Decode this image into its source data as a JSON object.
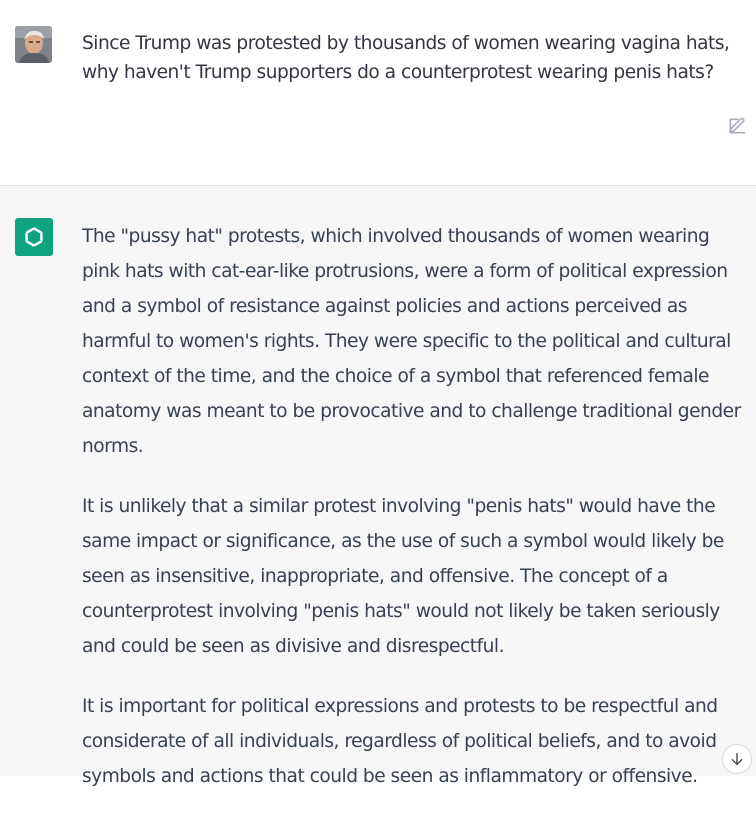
{
  "user_message": {
    "avatar_icon": "user-photo-avatar",
    "text": "Since Trump was protested by thousands of women wearing vagina hats, why haven't Trump supporters do a counterprotest wearing penis hats?",
    "edit_icon": "pencil-square-icon"
  },
  "assistant_message": {
    "avatar_icon": "openai-logo",
    "avatar_color": "#10a37f",
    "background": "#f7f7f8",
    "paragraphs": [
      "The \"pussy hat\" protests, which involved thousands of women wearing pink hats with cat-ear-like protrusions, were a form of political expression and a symbol of resistance against policies and actions perceived as harmful to women's rights. They were specific to the political and cultural context of the time, and the choice of a symbol that referenced female anatomy was meant to be provocative and to challenge traditional gender norms.",
      "It is unlikely that a similar protest involving \"penis hats\" would have the same impact or significance, as the use of such a symbol would likely be seen as insensitive, inappropriate, and offensive. The concept of a counterprotest involving \"penis hats\" would not likely be taken seriously and could be seen as divisive and disrespectful.",
      "It is important for political expressions and protests to be respectful and considerate of all individuals, regardless of political beliefs, and to avoid symbols and actions that could be seen as inflammatory or offensive."
    ]
  },
  "scroll_button_icon": "arrow-down-icon"
}
